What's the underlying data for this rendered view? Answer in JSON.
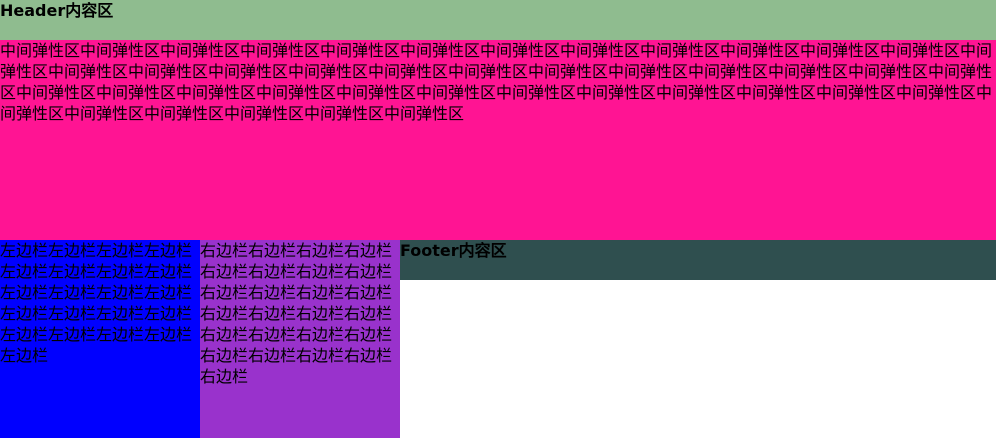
{
  "header": {
    "text": "Header内容区",
    "bg": "#8fbc8f"
  },
  "main": {
    "text": "中间弹性区中间弹性区中间弹性区中间弹性区中间弹性区中间弹性区中间弹性区中间弹性区中间弹性区中间弹性区中间弹性区中间弹性区中间弹性区中间弹性区中间弹性区中间弹性区中间弹性区中间弹性区中间弹性区中间弹性区中间弹性区中间弹性区中间弹性区中间弹性区中间弹性区中间弹性区中间弹性区中间弹性区中间弹性区中间弹性区中间弹性区中间弹性区中间弹性区中间弹性区中间弹性区中间弹性区中间弹性区中间弹性区中间弹性区中间弹性区中间弹性区中间弹性区中间弹性区",
    "bg": "#ff1493"
  },
  "left_sidebar": {
    "text": "左边栏左边栏左边栏左边栏左边栏左边栏左边栏左边栏左边栏左边栏左边栏左边栏左边栏左边栏左边栏左边栏左边栏左边栏左边栏左边栏左边栏",
    "bg": "#0000ff"
  },
  "right_sidebar": {
    "text": "右边栏右边栏右边栏右边栏右边栏右边栏右边栏右边栏右边栏右边栏右边栏右边栏右边栏右边栏右边栏右边栏右边栏右边栏右边栏右边栏右边栏右边栏右边栏右边栏右边栏",
    "bg": "#9932cc"
  },
  "footer": {
    "text": "Footer内容区",
    "bg": "#2f4f4f"
  }
}
